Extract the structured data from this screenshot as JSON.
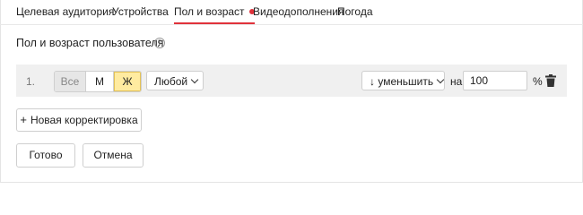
{
  "tabs": [
    {
      "label": "Целевая аудитория"
    },
    {
      "label": "Устройства"
    },
    {
      "label": "Пол и возраст",
      "active": true
    },
    {
      "label": "Видеодополнения"
    },
    {
      "label": "Погода"
    }
  ],
  "section": {
    "title": "Пол и возраст пользователя",
    "help_icon": "?"
  },
  "rule": {
    "number": "1.",
    "gender_options": [
      "Все",
      "М",
      "Ж"
    ],
    "gender_selected": "Ж",
    "age_value": "Любой",
    "adjust_value": "↓ уменьшить",
    "on_label": "на",
    "amount": "100",
    "percent_sign": "%"
  },
  "actions": {
    "add_label": "Новая корректировка",
    "add_icon": "+",
    "done_label": "Готово",
    "cancel_label": "Отмена"
  },
  "colors": {
    "accent_red": "#e0323b",
    "selected_yellow": "#ffeba0"
  }
}
